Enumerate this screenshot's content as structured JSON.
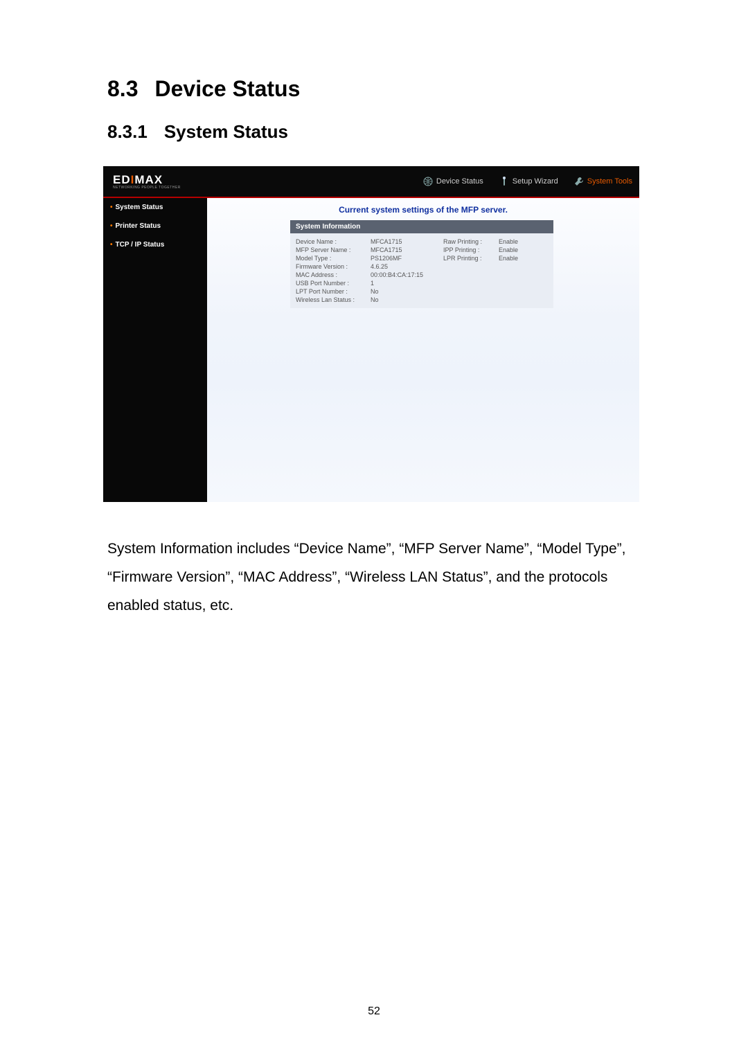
{
  "doc": {
    "section_number": "8.3",
    "section_title": "Device Status",
    "subsection_number": "8.3.1",
    "subsection_title": "System Status",
    "body": "System Information includes “Device Name”, “MFP Server Name”, “Model Type”, “Firmware Version”, “MAC Address”, “Wireless LAN Status”, and the protocols enabled status, etc.",
    "page_number": "52"
  },
  "ui": {
    "brand_main": "EDIMAX",
    "brand_sub": "NETWORKING PEOPLE TOGETHER",
    "topnav": {
      "device_status": "Device Status",
      "setup_wizard": "Setup Wizard",
      "system_tools": "System Tools"
    },
    "sidebar": {
      "system_status": "System Status",
      "printer_status": "Printer Status",
      "tcpip_status": "TCP / IP Status"
    },
    "content_title": "Current system settings of the MFP server.",
    "panel_header": "System Information",
    "info": {
      "rows": [
        {
          "label": "Device Name :",
          "value": "MFCA1715",
          "p_label": "Raw Printing :",
          "p_value": "Enable"
        },
        {
          "label": "MFP Server Name :",
          "value": "MFCA1715",
          "p_label": "IPP Printing :",
          "p_value": "Enable"
        },
        {
          "label": "Model Type :",
          "value": "PS1206MF",
          "p_label": "LPR Printing :",
          "p_value": "Enable"
        },
        {
          "label": "Firmware Version :",
          "value": "4.6.25",
          "p_label": "",
          "p_value": ""
        },
        {
          "label": "MAC Address :",
          "value": "00:00:B4:CA:17:15",
          "p_label": "",
          "p_value": ""
        },
        {
          "label": "USB Port Number :",
          "value": "1",
          "p_label": "",
          "p_value": ""
        },
        {
          "label": "LPT Port Number :",
          "value": "No",
          "p_label": "",
          "p_value": ""
        },
        {
          "label": "Wireless Lan Status :",
          "value": "No",
          "p_label": "",
          "p_value": ""
        }
      ]
    }
  }
}
